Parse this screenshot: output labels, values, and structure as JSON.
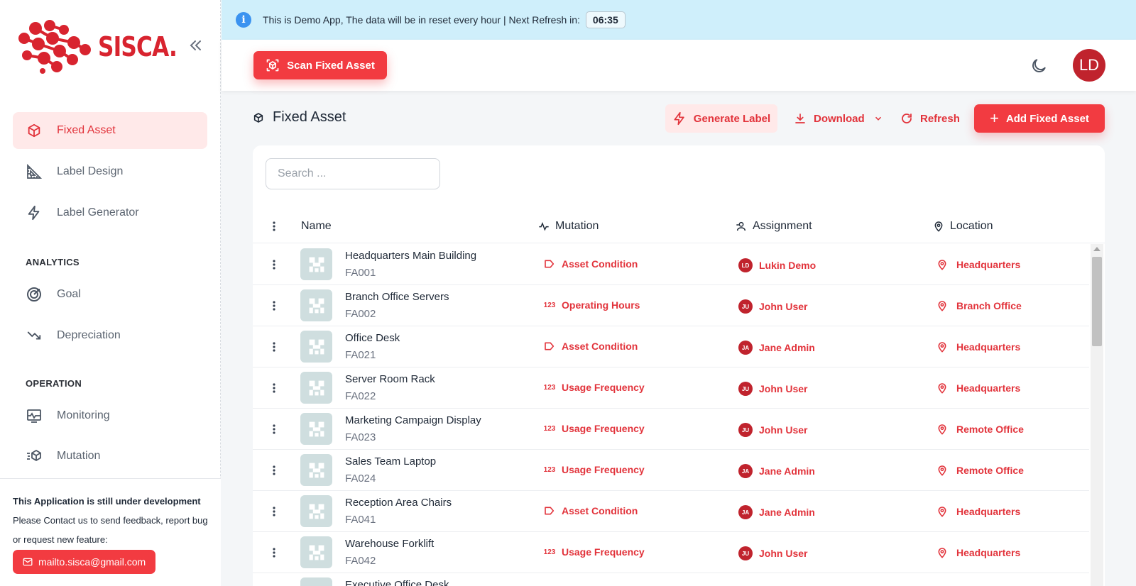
{
  "app": {
    "name": "SISCA.",
    "brand_color": "#d8242f"
  },
  "sidebar": {
    "items": [
      {
        "label": "Fixed Asset",
        "icon": "cube-icon",
        "active": true
      },
      {
        "label": "Label Design",
        "icon": "ruler-icon"
      },
      {
        "label": "Label Generator",
        "icon": "bolt-icon"
      }
    ],
    "analytics_title": "ANALYTICS",
    "analytics": [
      {
        "label": "Goal",
        "icon": "target-icon"
      },
      {
        "label": "Depreciation",
        "icon": "trend-down-icon"
      }
    ],
    "operation_title": "OPERATION",
    "operation": [
      {
        "label": "Monitoring",
        "icon": "monitor-icon"
      },
      {
        "label": "Mutation",
        "icon": "cube-move-icon"
      }
    ],
    "dev_notice": {
      "title": "This Application is still under development",
      "text": "Please Contact us to send feedback, report bug or request new feature:",
      "email_button": "mailto.sisca@gmail.com"
    }
  },
  "banner": {
    "text": "This is Demo App, The data will be in reset every hour | Next Refresh in:",
    "timer": "06:35"
  },
  "topbar": {
    "scan_button": "Scan Fixed Asset",
    "avatar_initials": "LD"
  },
  "page": {
    "title": "Fixed Asset",
    "actions": {
      "generate_label": "Generate Label",
      "download": "Download",
      "refresh": "Refresh",
      "add": "Add Fixed Asset"
    },
    "search_placeholder": "Search ..."
  },
  "table": {
    "columns": {
      "name": "Name",
      "mutation": "Mutation",
      "assignment": "Assignment",
      "location": "Location"
    },
    "rows": [
      {
        "name": "Headquarters Main Building",
        "code": "FA001",
        "mutation": "Asset Condition",
        "mutation_type": "condition",
        "assignee": "Lukin Demo",
        "assignee_initials": "LD",
        "location": "Headquarters"
      },
      {
        "name": "Branch Office Servers",
        "code": "FA002",
        "mutation": "Operating Hours",
        "mutation_type": "numeric",
        "assignee": "John User",
        "assignee_initials": "JU",
        "location": "Branch Office"
      },
      {
        "name": "Office Desk",
        "code": "FA021",
        "mutation": "Asset Condition",
        "mutation_type": "condition",
        "assignee": "Jane Admin",
        "assignee_initials": "JA",
        "location": "Headquarters"
      },
      {
        "name": "Server Room Rack",
        "code": "FA022",
        "mutation": "Usage Frequency",
        "mutation_type": "numeric",
        "assignee": "John User",
        "assignee_initials": "JU",
        "location": "Headquarters"
      },
      {
        "name": "Marketing Campaign Display",
        "code": "FA023",
        "mutation": "Usage Frequency",
        "mutation_type": "numeric",
        "assignee": "John User",
        "assignee_initials": "JU",
        "location": "Remote Office"
      },
      {
        "name": "Sales Team Laptop",
        "code": "FA024",
        "mutation": "Usage Frequency",
        "mutation_type": "numeric",
        "assignee": "Jane Admin",
        "assignee_initials": "JA",
        "location": "Remote Office"
      },
      {
        "name": "Reception Area Chairs",
        "code": "FA041",
        "mutation": "Asset Condition",
        "mutation_type": "condition",
        "assignee": "Jane Admin",
        "assignee_initials": "JA",
        "location": "Headquarters"
      },
      {
        "name": "Warehouse Forklift",
        "code": "FA042",
        "mutation": "Usage Frequency",
        "mutation_type": "numeric",
        "assignee": "John User",
        "assignee_initials": "JU",
        "location": "Headquarters"
      },
      {
        "name": "Executive Office Desk",
        "code": "",
        "mutation": "",
        "mutation_type": "",
        "assignee": "",
        "assignee_initials": "",
        "location": ""
      }
    ]
  }
}
